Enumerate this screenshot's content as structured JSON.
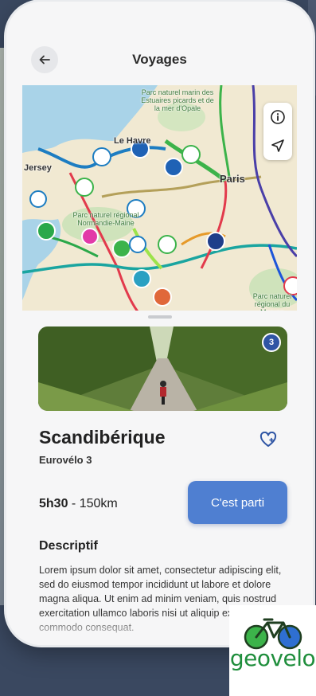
{
  "header": {
    "title": "Voyages"
  },
  "map": {
    "labels": {
      "park1": "Parc naturel marin des Estuaires picards et de la mer d'Opale",
      "park2": "Parc naturel régional Normandie-Maine",
      "park3": "Parc naturel régional du Morvan",
      "city1": "Le Havre",
      "city2": "Paris",
      "jersey": "Jersey"
    }
  },
  "route": {
    "name": "Scandibérique",
    "subtitle": "Eurovélo 3",
    "badge": "3",
    "duration": "5h30",
    "distance": " - 150km",
    "cta": "C'est parti"
  },
  "description": {
    "title": "Descriptif",
    "text": "Lorem ipsum dolor sit amet, consectetur adipiscing elit, sed do eiusmod tempor incididunt ut labore et dolore magna aliqua. Ut enim ad minim veniam, quis nostrud exercitation ullamco laboris nisi ut aliquip ex ea commodo consequat."
  },
  "brand": {
    "logo_text": "geovelo"
  },
  "colors": {
    "accent": "#4f7fd1",
    "brand_green": "#1f8e3c",
    "brand_blue": "#2f6fd1"
  }
}
